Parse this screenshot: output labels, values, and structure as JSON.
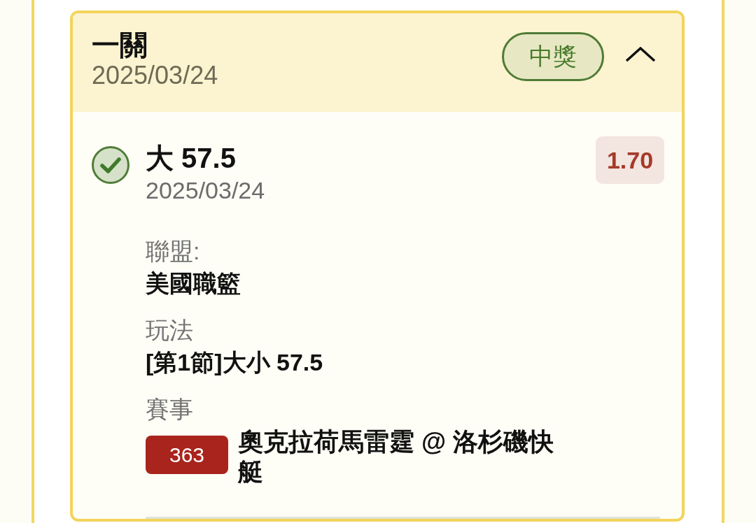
{
  "ticket": {
    "title": "一關",
    "date": "2025/03/24",
    "status": {
      "label": "中獎",
      "kind": "won"
    },
    "expanded": true,
    "selections": [
      {
        "won": true,
        "pick": "大 57.5",
        "date": "2025/03/24",
        "odds": "1.70",
        "details": [
          {
            "label": "聯盟:",
            "value": "美國職籃"
          },
          {
            "label": "玩法",
            "value": "[第1節]大小 57.5"
          }
        ],
        "event": {
          "label": "賽事",
          "number": "363",
          "name": "奧克拉荷馬雷霆 @ 洛杉磯快艇"
        }
      }
    ]
  }
}
